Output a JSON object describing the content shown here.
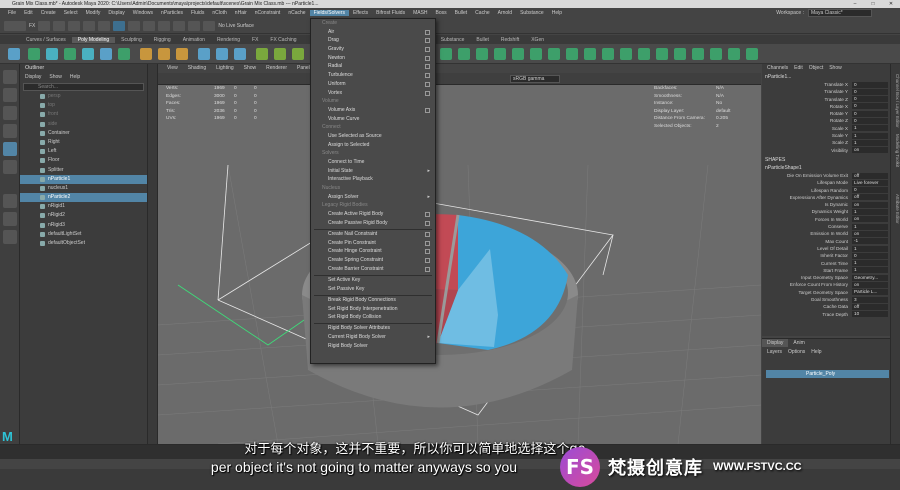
{
  "titlebar": {
    "text": "Grain Mix Class.mb* - Autodesk Maya 2020: C:\\Users\\Admin\\Documents\\maya\\projects\\default\\scenes\\Grain Mix Class.mb  ---  nParticle1...",
    "min": "–",
    "max": "□",
    "close": "✕"
  },
  "menubar": [
    "File",
    "Edit",
    "Create",
    "Select",
    "Modify",
    "Display",
    "Windows",
    "nParticles",
    "Fluids",
    "nCloth",
    "nHair",
    "nConstraint",
    "nCache",
    "Fields/Solvers",
    "Effects",
    "Bifrost Fluids",
    "MASH",
    "Boss",
    "Bullet",
    "Cache",
    "Arnold",
    "Substance",
    "Help"
  ],
  "active_menu": "Fields/Solvers",
  "workspace": {
    "label": "Workspace :",
    "value": "Maya Classic*"
  },
  "statusline": {
    "mode": "FX",
    "surface": "No Live Surface"
  },
  "shelf_tabs": [
    "Curves / Surfaces",
    "Poly Modeling",
    "Sculpting",
    "Rigging",
    "Animation",
    "Rendering",
    "FX",
    "FX Caching",
    "",
    "",
    "",
    "",
    "",
    "",
    "",
    "",
    "n Graphics",
    "Substance",
    "Bullet",
    "Redshift",
    "XGen"
  ],
  "outliner": {
    "title": "Outliner",
    "menu": [
      "Display",
      "Show",
      "Help"
    ],
    "search_placeholder": "Search...",
    "items": [
      {
        "label": "persp",
        "state": "dim"
      },
      {
        "label": "top",
        "state": "dim"
      },
      {
        "label": "front",
        "state": "dim"
      },
      {
        "label": "side",
        "state": "dim"
      },
      {
        "label": "Container",
        "state": ""
      },
      {
        "label": "Right",
        "state": ""
      },
      {
        "label": "Left",
        "state": ""
      },
      {
        "label": "Floor",
        "state": ""
      },
      {
        "label": "Splitter",
        "state": ""
      },
      {
        "label": "nParticle1",
        "state": "sel"
      },
      {
        "label": "nucleus1",
        "state": ""
      },
      {
        "label": "nParticle2",
        "state": "sel"
      },
      {
        "label": "nRigid1",
        "state": ""
      },
      {
        "label": "nRigid2",
        "state": ""
      },
      {
        "label": "nRigid3",
        "state": ""
      },
      {
        "label": "defaultLightSet",
        "state": ""
      },
      {
        "label": "defaultObjectSet",
        "state": ""
      }
    ]
  },
  "viewport": {
    "menu": [
      "View",
      "Shading",
      "Lighting",
      "Show",
      "Renderer",
      "Panels"
    ],
    "gamma": "sRGB gamma",
    "hud_left_labels": [
      "Verts:",
      "Edges:",
      "Faces:",
      "Tris:",
      "UVs:"
    ],
    "hud_left_v1": [
      "1969",
      "3000",
      "1969",
      "2036",
      "1969"
    ],
    "hud_left_v2": [
      "0",
      "0",
      "0",
      "0",
      "0"
    ],
    "hud_left_v3": [
      "0",
      "0",
      "0",
      "0",
      "0"
    ],
    "hud_right_labels": [
      "Backfaces:",
      "Smoothness:",
      "Instance:",
      "Display Layer:",
      "Distance From Camera:",
      "Selected Objects:"
    ],
    "hud_right_values": [
      "N/A",
      "N/A",
      "No",
      "default",
      "0.205",
      "2"
    ]
  },
  "context_menu": [
    {
      "type": "hdr",
      "label": "Create"
    },
    {
      "type": "item",
      "label": "Air",
      "box": true
    },
    {
      "type": "item",
      "label": "Drag",
      "box": true
    },
    {
      "type": "item",
      "label": "Gravity",
      "box": true
    },
    {
      "type": "item",
      "label": "Newton",
      "box": true
    },
    {
      "type": "item",
      "label": "Radial",
      "box": true
    },
    {
      "type": "item",
      "label": "Turbulence",
      "box": true
    },
    {
      "type": "item",
      "label": "Uniform",
      "box": true
    },
    {
      "type": "item",
      "label": "Vortex",
      "box": true
    },
    {
      "type": "hdr",
      "label": "Volume"
    },
    {
      "type": "item",
      "label": "Volume Axis",
      "box": true
    },
    {
      "type": "item",
      "label": "Volume Curve",
      "box": false
    },
    {
      "type": "hdr",
      "label": "Connect"
    },
    {
      "type": "item",
      "label": "Use Selected as Source",
      "box": false
    },
    {
      "type": "item",
      "label": "Assign to Selected",
      "box": false
    },
    {
      "type": "hdr",
      "label": "Solvers"
    },
    {
      "type": "item",
      "label": "Connect to Time",
      "box": false
    },
    {
      "type": "item",
      "label": "Initial State",
      "arrow": true
    },
    {
      "type": "item",
      "label": "Interactive Playback",
      "box": false
    },
    {
      "type": "hdr",
      "label": "Nucleus"
    },
    {
      "type": "item",
      "label": "Assign Solver",
      "arrow": true
    },
    {
      "type": "hdr",
      "label": "Legacy Rigid Bodies"
    },
    {
      "type": "item",
      "label": "Create Active Rigid Body",
      "box": true
    },
    {
      "type": "item",
      "label": "Create Passive Rigid Body",
      "box": true
    },
    {
      "type": "sep"
    },
    {
      "type": "item",
      "label": "Create Nail Constraint",
      "box": true
    },
    {
      "type": "item",
      "label": "Create Pin Constraint",
      "box": true
    },
    {
      "type": "item",
      "label": "Create Hinge Constraint",
      "box": true
    },
    {
      "type": "item",
      "label": "Create Spring Constraint",
      "box": true
    },
    {
      "type": "item",
      "label": "Create Barrier Constraint",
      "box": true
    },
    {
      "type": "sep"
    },
    {
      "type": "item",
      "label": "Set Active Key",
      "box": false
    },
    {
      "type": "item",
      "label": "Set Passive Key",
      "box": false
    },
    {
      "type": "sep"
    },
    {
      "type": "item",
      "label": "Break Rigid Body Connections",
      "box": false
    },
    {
      "type": "item",
      "label": "Set Rigid Body Interpenetration",
      "box": false
    },
    {
      "type": "item",
      "label": "Set Rigid Body Collision",
      "box": false
    },
    {
      "type": "sep"
    },
    {
      "type": "item",
      "label": "Rigid Body Solver Attributes",
      "box": false
    },
    {
      "type": "item",
      "label": "Current Rigid Body Solver",
      "arrow": true
    },
    {
      "type": "item",
      "label": "Rigid Body Solver",
      "box": false
    }
  ],
  "channel_box": {
    "menu": [
      "Channels",
      "Edit",
      "Object",
      "Show"
    ],
    "object": "nParticle1...",
    "transform": [
      {
        "k": "Translate X",
        "v": "0"
      },
      {
        "k": "Translate Y",
        "v": "0"
      },
      {
        "k": "Translate Z",
        "v": "0"
      },
      {
        "k": "Rotate X",
        "v": "0"
      },
      {
        "k": "Rotate Y",
        "v": "0"
      },
      {
        "k": "Rotate Z",
        "v": "0"
      },
      {
        "k": "Scale X",
        "v": "1"
      },
      {
        "k": "Scale Y",
        "v": "1"
      },
      {
        "k": "Scale Z",
        "v": "1"
      },
      {
        "k": "Visibility",
        "v": "on"
      }
    ],
    "shapes_label": "SHAPES",
    "shape_name": "nParticleShape1",
    "shape_attrs": [
      {
        "k": "Die On Emission Volume Exit",
        "v": "off"
      },
      {
        "k": "Lifespan Mode",
        "v": "Live forever"
      },
      {
        "k": "Lifespan Random",
        "v": "0"
      },
      {
        "k": "Expressions After Dynamics",
        "v": "off"
      },
      {
        "k": "Is Dynamic",
        "v": "on"
      },
      {
        "k": "Dynamics Weight",
        "v": "1"
      },
      {
        "k": "Forces In World",
        "v": "on"
      },
      {
        "k": "Conserve",
        "v": "1"
      },
      {
        "k": "Emission In World",
        "v": "on"
      },
      {
        "k": "Max Count",
        "v": "-1"
      },
      {
        "k": "Level Of Detail",
        "v": "1"
      },
      {
        "k": "Inherit Factor",
        "v": "0"
      },
      {
        "k": "Current Time",
        "v": "1"
      },
      {
        "k": "Start Frame",
        "v": "1"
      },
      {
        "k": "Input Geometry Space",
        "v": "Geometry..."
      },
      {
        "k": "Enforce Count From History",
        "v": "on"
      },
      {
        "k": "Target Geometry Space",
        "v": "Particle L..."
      },
      {
        "k": "Goal Smoothness",
        "v": "3"
      },
      {
        "k": "Cache Data",
        "v": "off"
      },
      {
        "k": "Trace Depth",
        "v": "10"
      }
    ]
  },
  "layers": {
    "tabs": [
      "Display",
      "Anim"
    ],
    "menu": [
      "Layers",
      "Options",
      "Help"
    ],
    "row": "Particle_Poly"
  },
  "right_strip": [
    "Channel Box / Layer Editor",
    "Modelling Toolkit",
    "Attribute Editor"
  ],
  "subtitle": {
    "cn": "对于每个对象，这并不重要，所以你可以简单地选择这个go",
    "en": "per object it's not going to matter anyways so you"
  },
  "watermark": {
    "logo": "FS",
    "cn": "梵摄创意库",
    "url": "WWW.FSTVC.CC"
  },
  "colors": {
    "accent": "#5285a6",
    "particles_blue": "#3da5d9",
    "particles_red": "#d9555e",
    "container": "#7a7a7a"
  }
}
